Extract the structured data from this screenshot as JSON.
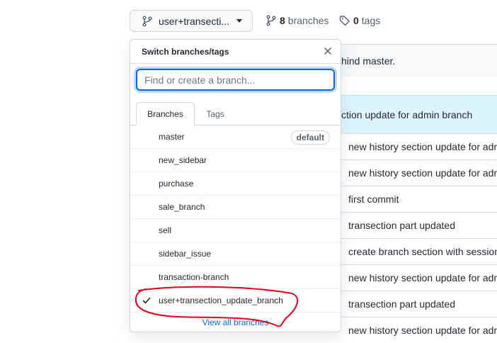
{
  "top_bar": {
    "branch_button_label": "user+transecti...",
    "branches_count": "8",
    "branches_label": "branches",
    "tags_count": "0",
    "tags_label": "tags"
  },
  "background": {
    "behind_text": "hind master.",
    "latest_commit": "ction update for admin branch",
    "commit_messages": [
      "new history section update for admin branch",
      "new history section update for admin branch",
      "first commit",
      "transection part updated",
      "create branch section with session",
      "new history section update for admin branch",
      "transection part updated",
      "new history section update for admin branch"
    ]
  },
  "dropdown": {
    "title": "Switch branches/tags",
    "filter_placeholder": "Find or create a branch...",
    "tabs": [
      "Branches",
      "Tags"
    ],
    "active_tab": "Branches",
    "default_badge": "default",
    "branches": [
      "master",
      "new_sidebar",
      "purchase",
      "sale_branch",
      "sell",
      "sidebar_issue",
      "transaction-branch",
      "user+transection_update_branch"
    ],
    "selected_branch": "user+transection_update_branch",
    "footer_link": "View all branches"
  },
  "colors": {
    "accent": "#0969da",
    "annotation": "#e0001b"
  }
}
